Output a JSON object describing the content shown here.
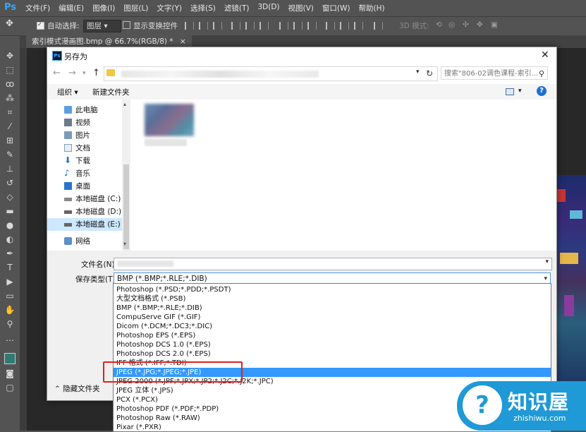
{
  "photoshop": {
    "logo": "Ps",
    "menu": [
      "文件(F)",
      "编辑(E)",
      "图像(I)",
      "图层(L)",
      "文字(Y)",
      "选择(S)",
      "滤镜(T)",
      "3D(D)",
      "视图(V)",
      "窗口(W)",
      "帮助(H)"
    ],
    "options": {
      "auto_select_label": "自动选择:",
      "layer_value": "图层",
      "show_transform_label": "显示变换控件",
      "mode_3d_label": "3D 模式:"
    },
    "document_tab": "索引模式漫画图.bmp @ 66.7%(RGB/8) *"
  },
  "dialog": {
    "title": "另存为",
    "close_icon": "close-icon",
    "search_placeholder": "搜索\"806-02调色课程-索引...",
    "toolbar": {
      "organize": "组织 ▾",
      "new_folder": "新建文件夹"
    },
    "nav_items": [
      {
        "label": "此电脑",
        "icon": "computer-icon"
      },
      {
        "label": "视频",
        "icon": "video-icon"
      },
      {
        "label": "图片",
        "icon": "pictures-icon"
      },
      {
        "label": "文档",
        "icon": "documents-icon"
      },
      {
        "label": "下载",
        "icon": "download-icon"
      },
      {
        "label": "音乐",
        "icon": "music-icon"
      },
      {
        "label": "桌面",
        "icon": "desktop-icon"
      },
      {
        "label": "本地磁盘 (C:)",
        "icon": "drive-icon"
      },
      {
        "label": "本地磁盘 (D:)",
        "icon": "drive-icon"
      },
      {
        "label": "本地磁盘 (E:)",
        "icon": "drive-icon"
      },
      {
        "label": "网络",
        "icon": "network-icon"
      }
    ],
    "filename_label": "文件名(N)",
    "filetype_label": "保存类型(T):",
    "filetype_value": "BMP (*.BMP;*.RLE;*.DIB)",
    "hide_folders": "隐藏文件夹"
  },
  "dropdown": {
    "items": [
      "Photoshop (*.PSD;*.PDD;*.PSDT)",
      "大型文档格式 (*.PSB)",
      "BMP (*.BMP;*.RLE;*.DIB)",
      "CompuServe GIF (*.GIF)",
      "Dicom (*.DCM;*.DC3;*.DIC)",
      "Photoshop EPS (*.EPS)",
      "Photoshop DCS 1.0 (*.EPS)",
      "Photoshop DCS 2.0 (*.EPS)",
      "IFF 格式 (*.IFF;*.TDI)",
      "JPEG (*.JPG;*.JPEG;*.JPE)",
      "JPEG 2000 (*.JPF;*.JPX;*.JP2;*.J2C;*.J2K;*.JPC)",
      "JPEG 立体 (*.JPS)",
      "PCX (*.PCX)",
      "Photoshop PDF (*.PDF;*.PDP)",
      "Photoshop Raw (*.RAW)",
      "Pixar (*.PXR)"
    ],
    "selected_index": 9
  },
  "watermark": {
    "cn": "知识屋",
    "en": "zhishiwu.com"
  },
  "colors": {
    "selection": "#3399ff",
    "highlight_box": "#e02020",
    "ps_bg": "#535353"
  }
}
